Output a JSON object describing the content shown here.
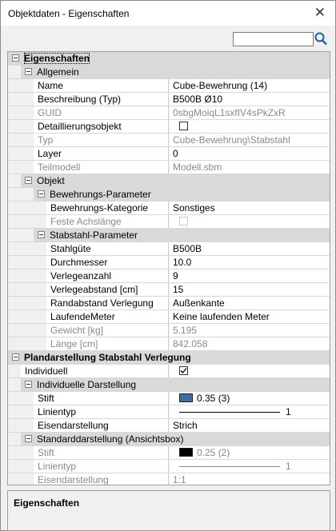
{
  "window": {
    "title": "Objektdaten - Eigenschaften",
    "close_glyph": "✕"
  },
  "search": {
    "value": "",
    "placeholder": "",
    "icon": "search-icon"
  },
  "grid": {
    "root": "Eigenschaften",
    "general": {
      "title": "Allgemein",
      "name": {
        "label": "Name",
        "value": "Cube-Bewehrung (14)"
      },
      "beschreibung": {
        "label": "Beschreibung (Typ)",
        "value": "B500B Ø10"
      },
      "guid": {
        "label": "GUID",
        "value": "0sbgMoiqL1sxfIV4sPkZxR"
      },
      "detail": {
        "label": "Detaillierungsobjekt",
        "checked": false
      },
      "typ": {
        "label": "Typ",
        "value": "Cube-Bewehrung\\Stabstahl"
      },
      "layer": {
        "label": "Layer",
        "value": "0"
      },
      "teilmodell": {
        "label": "Teilmodell",
        "value": "Modell.sbm"
      }
    },
    "objekt": {
      "title": "Objekt",
      "bewehrung": {
        "title": "Bewehrungs-Parameter",
        "kategorie": {
          "label": "Bewehrungs-Kategorie",
          "value": "Sonstiges"
        },
        "achslaenge": {
          "label": "Feste Achslänge",
          "checked": false
        }
      },
      "stabstahl": {
        "title": "Stabstahl-Parameter",
        "stahlguete": {
          "label": "Stahlgüte",
          "value": "B500B"
        },
        "durchmesser": {
          "label": "Durchmesser",
          "value": "10.0"
        },
        "verlegeanzahl": {
          "label": "Verlegeanzahl",
          "value": "9"
        },
        "verlegeabstand": {
          "label": "Verlegeabstand [cm]",
          "value": "15"
        },
        "randabstand": {
          "label": "Randabstand Verlegung",
          "value": "Außenkante"
        },
        "laufende": {
          "label": "LaufendeMeter",
          "value": "Keine laufenden Meter"
        },
        "gewicht": {
          "label": "Gewicht [kg]",
          "value": "5.195"
        },
        "laenge": {
          "label": "Länge [cm]",
          "value": "842.058"
        }
      }
    },
    "plan": {
      "title": "Plandarstellung Stabstahl Verlegung",
      "individuell": {
        "label": "Individuell",
        "checked": true
      },
      "ind_darst": {
        "title": "Individuelle Darstellung",
        "stift": {
          "label": "Stift",
          "value": "0.35 (3)",
          "color": "#3a6ea5"
        },
        "linientyp": {
          "label": "Linientyp",
          "value": "1"
        },
        "eisen": {
          "label": "Eisendarstellung",
          "value": "Strich"
        }
      },
      "std_darst": {
        "title": "Standarddarstellung (Ansichtsbox)",
        "stift": {
          "label": "Stift",
          "value": "0.25 (2)",
          "color": "#000000"
        },
        "linientyp": {
          "label": "Linientyp",
          "value": "1"
        },
        "eisen": {
          "label": "Eisendarstellung",
          "value": "1:1"
        }
      }
    }
  },
  "description": {
    "title": "Eigenschaften"
  }
}
